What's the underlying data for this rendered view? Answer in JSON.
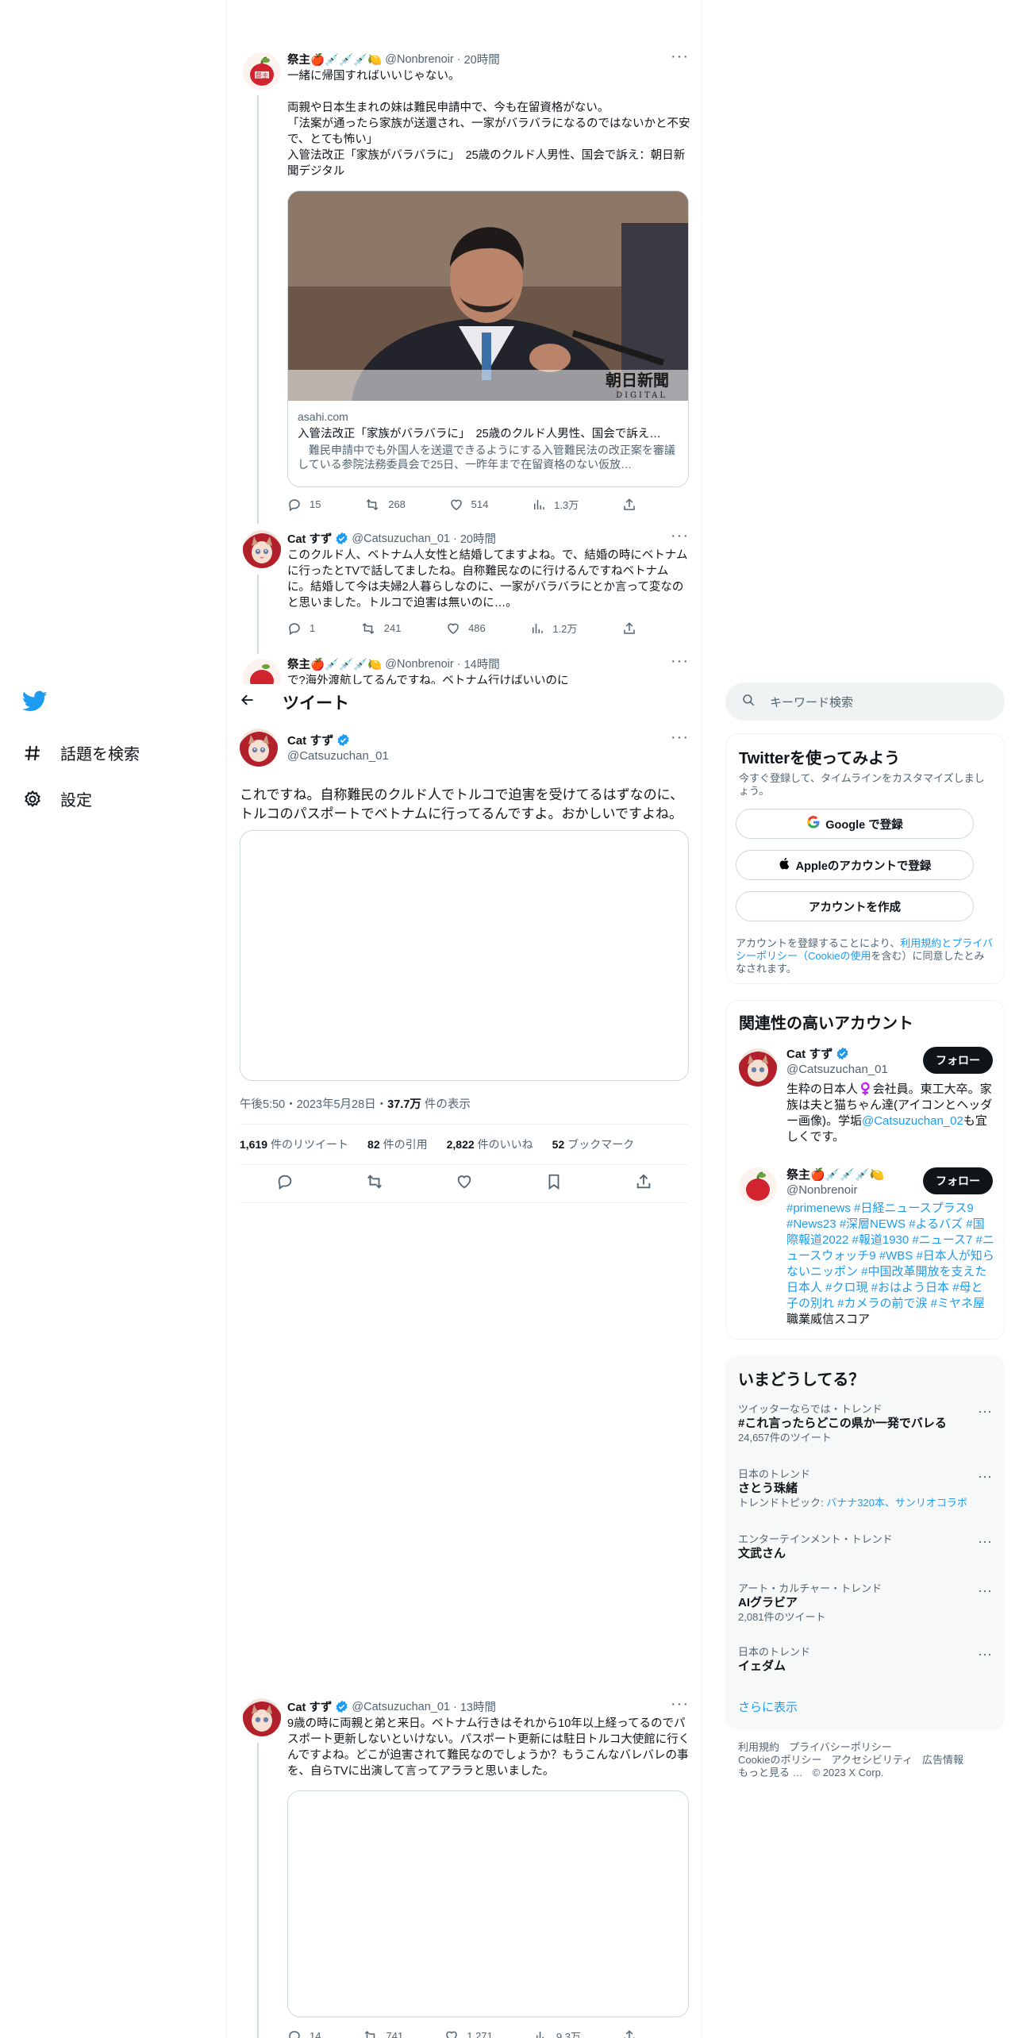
{
  "nav": {
    "logo": "twitter-bird-icon",
    "explore_label": "話題を検索",
    "settings_label": "設定"
  },
  "thread_top": [
    {
      "name": "祭主🍎💉💉💉🍋",
      "handle": "@Nonbrenoir",
      "time": "20時間",
      "body": "一緒に帰国すればいいじゃない。\n\n両親や日本生まれの妹は難民申請中で、今も在留資格がない。\n「法案が通ったら家族が送還され、一家がバラバラになるのではないかと不安で、とても怖い」\n入管法改正「家族がバラバラに」　25歳のクルド人男性、国会で訴え：朝日新聞デジタル",
      "card": {
        "domain": "asahi.com",
        "title": "入管法改正「家族がバラバラに」　25歳のクルド人男性、国会で訴え…",
        "desc": "　難民申請中でも外国人を送還できるようにする入管難民法の改正案を審議している参院法務委員会で25日、一昨年まで在留資格のない仮放…",
        "watermark1": "朝日新聞",
        "watermark2": "DIGITAL"
      },
      "replies": "15",
      "retweets": "268",
      "likes": "514",
      "views": "1.3万"
    },
    {
      "name": "Cat すず",
      "handle": "@Catsuzuchan_01",
      "time": "20時間",
      "body": "このクルド人、ベトナム人女性と結婚してますよね。で、結婚の時にベトナムに行ったとTVで話してましたね。自称難民なのに行けるんですねベトナムに。結婚して今は夫婦2人暮らしなのに、一家がバラバラにとか言って変なのと思いました。トルコで迫害は無いのに…。",
      "replies": "1",
      "retweets": "241",
      "likes": "486",
      "views": "1.2万"
    },
    {
      "name": "祭主🍎💉💉💉🍋",
      "handle": "@Nonbrenoir",
      "time": "14時間",
      "body": "で?海外渡航してるんですね。ベトナム行けばいいのに"
    }
  ],
  "tweet_view": {
    "header_title": "ツイート",
    "name": "Cat すず",
    "handle": "@Catsuzuchan_01",
    "body": "これですね。自称難民のクルド人でトルコで迫害を受けてるはずなのに、トルコのパスポートでベトナムに行ってるんですよ。おかしいですよね。",
    "timestamp": "午後5:50・2023年5月28日・",
    "views_num": "37.7万",
    "views_label": " 件の表示",
    "stats": [
      {
        "num": "1,619",
        "label": "件のリツイート"
      },
      {
        "num": "82",
        "label": "件の引用"
      },
      {
        "num": "2,822",
        "label": "件のいいね"
      },
      {
        "num": "52",
        "label": "ブックマーク"
      }
    ]
  },
  "reply_bottom": {
    "name": "Cat すず",
    "handle": "@Catsuzuchan_01",
    "time": "13時間",
    "body": "9歳の時に両親と弟と来日。ベトナム行きはそれから10年以上経ってるのでパスポート更新しないといけない。パスポート更新には駐日トルコ大使館に行くんですよね。どこが迫害されて難民なのでしょうか？もうこんなバレバレの事を、自らTVに出演して言ってアララと思いました。",
    "replies": "14",
    "retweets": "741",
    "likes": "1,271",
    "views": "9.3万"
  },
  "right": {
    "search_placeholder": "キーワード検索",
    "signup": {
      "title": "Twitterを使ってみよう",
      "subtitle": "今すぐ登録して、タイムラインをカスタマイズしましょう。",
      "google_label": "Google で登録",
      "apple_label": "Appleのアカウントで登録",
      "create_label": "アカウントを作成",
      "legal_prefix": "アカウントを登録することにより、",
      "legal_link": "利用規約とプライバシーポリシー（Cookieの使用",
      "legal_suffix": "を含む）に同意したとみなされます。"
    },
    "related": {
      "title": "関連性の高いアカウント",
      "accounts": [
        {
          "name": "Cat すず",
          "handle": "@Catsuzuchan_01",
          "follow": "フォロー",
          "bio": "生粋の日本人♀️会社員。東工大卒。家族は夫と猫ちゃん達(アイコンとヘッダー画像)。学垢",
          "bio_link": "@Catsuzuchan_02",
          "bio_tail": "も宜しくです。"
        },
        {
          "name": "祭主🍎💉💉💉🍋",
          "handle": "@Nonbrenoir",
          "follow": "フォロー",
          "bio_tags": "#primenews #日経ニュースプラス9 #News23 #深層NEWS #よるバズ #国際報道2022 #報道1930 #ニュース7 #ニュースウォッチ9 #WBS #日本人が知らないニッポン #中国改革開放を支えた日本人 #クロ現 #おはよう日本 #母と子の別れ #カメラの前で涙 #ミヤネ屋",
          "bio_tail": " 職業威信スコア"
        }
      ]
    },
    "trends": {
      "title": "いまどうしてる？",
      "items": [
        {
          "ctx": "ツイッターならでは・トレンド",
          "name": "#これ言ったらどこの県か一発でバレる",
          "count": "24,657件のツイート"
        },
        {
          "ctx": "日本のトレンド",
          "name": "さとう珠緒",
          "count_prefix": "トレンドトピック: ",
          "count_link": "バナナ320本、サンリオコラボ"
        },
        {
          "ctx": "エンターテインメント・トレンド",
          "name": "文武さん",
          "count": ""
        },
        {
          "ctx": "アート・カルチャー・トレンド",
          "name": "AIグラビア",
          "count": "2,081件のツイート"
        },
        {
          "ctx": "日本のトレンド",
          "name": "イェダム",
          "count": ""
        }
      ],
      "show_more": "さらに表示"
    },
    "footer": {
      "line1": [
        "利用規約",
        "プライバシーポリシー"
      ],
      "line2": [
        "Cookieのポリシー",
        "アクセシビリティ",
        "広告情報"
      ],
      "line3": [
        "もっと見る …",
        "© 2023 X Corp."
      ]
    }
  }
}
